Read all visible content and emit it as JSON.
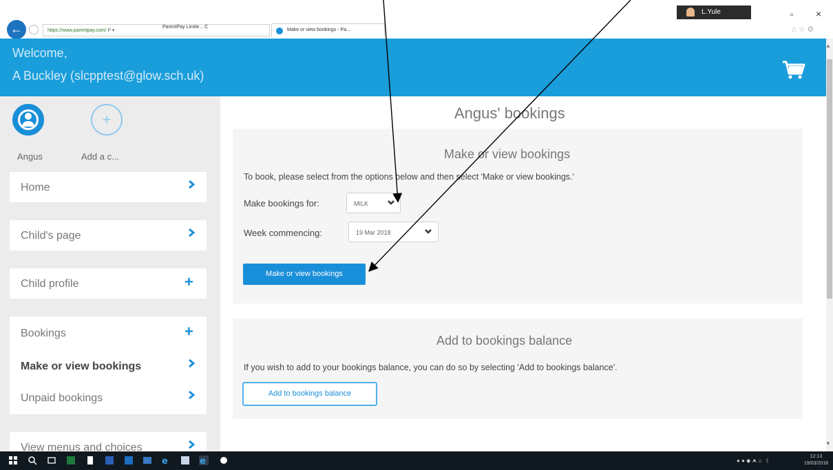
{
  "browser": {
    "address_url": "https://www.parentpay.com/",
    "address_hint": "P ▾",
    "site_tab": "ParentPay Limite... C",
    "active_tab": "Make or view bookings - Pa...",
    "user_name": "L.Yule",
    "restore_glyph": "▫",
    "close_glyph": "×",
    "chrome_icons": "⌂☆⚙"
  },
  "header": {
    "welcome": "Welcome,",
    "user": "A Buckley (slcpptest@glow.sch.uk)",
    "basket_icon": "cart-icon"
  },
  "sidebar": {
    "child_name": "Angus",
    "add_child": "Add a c...",
    "items": [
      {
        "label": "Home",
        "icon": "chevron-right"
      },
      {
        "label": "Child's page",
        "icon": "chevron-right"
      },
      {
        "label": "Child profile",
        "icon": "plus"
      },
      {
        "label": "Bookings",
        "icon": "plus"
      },
      {
        "label": "Make or view bookings",
        "icon": "chevron-right"
      },
      {
        "label": "Unpaid bookings",
        "icon": "chevron-right"
      },
      {
        "label": "View menus and choices",
        "icon": "chevron-right"
      }
    ]
  },
  "main": {
    "title": "Angus' bookings",
    "make_view": {
      "title": "Make or view bookings",
      "instructions": "To book, please select from the options below and then select 'Make or view bookings.'",
      "make_for_label": "Make bookings for:",
      "make_for_value": "MILK",
      "week_label": "Week commencing:",
      "week_value": "19 Mar 2018",
      "button": "Make or view bookings"
    },
    "balance": {
      "title": "Add to bookings balance",
      "text": "If you wish to add to your bookings balance, you can do so by selecting 'Add to bookings balance'.",
      "button": "Add to bookings balance"
    }
  },
  "taskbar": {
    "tray": "● ● ◆ ⮝ ⌂ 〈",
    "time": "12:13",
    "date": "19/03/2018"
  },
  "colors": {
    "brand_blue": "#1a9ddb",
    "button_blue": "#1a8fd9"
  }
}
